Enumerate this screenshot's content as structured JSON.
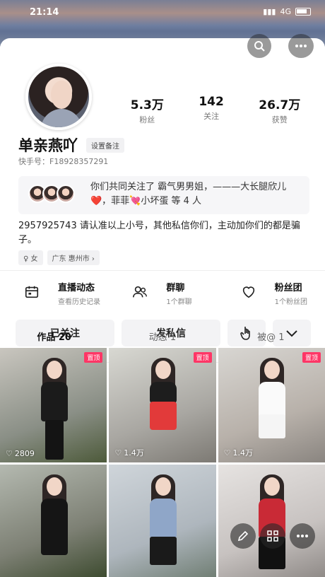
{
  "status_bar": {
    "time": "21:14",
    "network": "4G"
  },
  "header": {
    "search_icon": "search-icon",
    "more_icon": "more-icon"
  },
  "profile": {
    "name": "单亲燕吖",
    "remark_button": "设置备注",
    "user_id": "快手号：F18928357291",
    "stats": [
      {
        "value": "5.3万",
        "label": "粉丝"
      },
      {
        "value": "142",
        "label": "关注"
      },
      {
        "value": "26.7万",
        "label": "获赞"
      }
    ],
    "mutual_follow": "你们共同关注了 霸气男男姐，———大长腿欣儿❤️，菲菲💘小坏蛋 等 4 人",
    "bio": "2957925743 请认准以上小号，其他私信你们，主动加你们的都是骗子。",
    "tags": [
      "♀ 女",
      "广东 惠州市 ›"
    ]
  },
  "features": [
    {
      "title": "直播动态",
      "subtitle": "查看历史记录",
      "icon": "calendar-icon"
    },
    {
      "title": "群聊",
      "subtitle": "1个群聊",
      "icon": "group-chat-icon"
    },
    {
      "title": "粉丝团",
      "subtitle": "1个粉丝团",
      "icon": "heart-icon"
    }
  ],
  "actions": {
    "follow_label": "已关注",
    "message_label": "发私信",
    "touch_icon": "hand-pointer-icon",
    "dropdown_icon": "chevron-down-icon"
  },
  "tabs": [
    {
      "label": "作品 20",
      "active": true
    },
    {
      "label": "动态 1",
      "active": false
    },
    {
      "label": "被@ 1",
      "active": false
    }
  ],
  "works": [
    {
      "pinned_label": "置顶",
      "likes": "2809",
      "outfit": "black"
    },
    {
      "pinned_label": "置顶",
      "likes": "1.4万",
      "outfit": "red"
    },
    {
      "pinned_label": "置顶",
      "likes": "1.4万",
      "outfit": "white"
    },
    {
      "pinned_label": "",
      "likes": "",
      "outfit": "black"
    },
    {
      "pinned_label": "",
      "likes": "",
      "outfit": "denim"
    },
    {
      "pinned_label": "",
      "likes": "",
      "outfit": "red-black"
    }
  ],
  "floating_actions": [
    "edit-icon",
    "grid-icon",
    "more-icon"
  ],
  "colors": {
    "accent": "#fe3666",
    "text": "#111111",
    "muted": "#888888"
  }
}
